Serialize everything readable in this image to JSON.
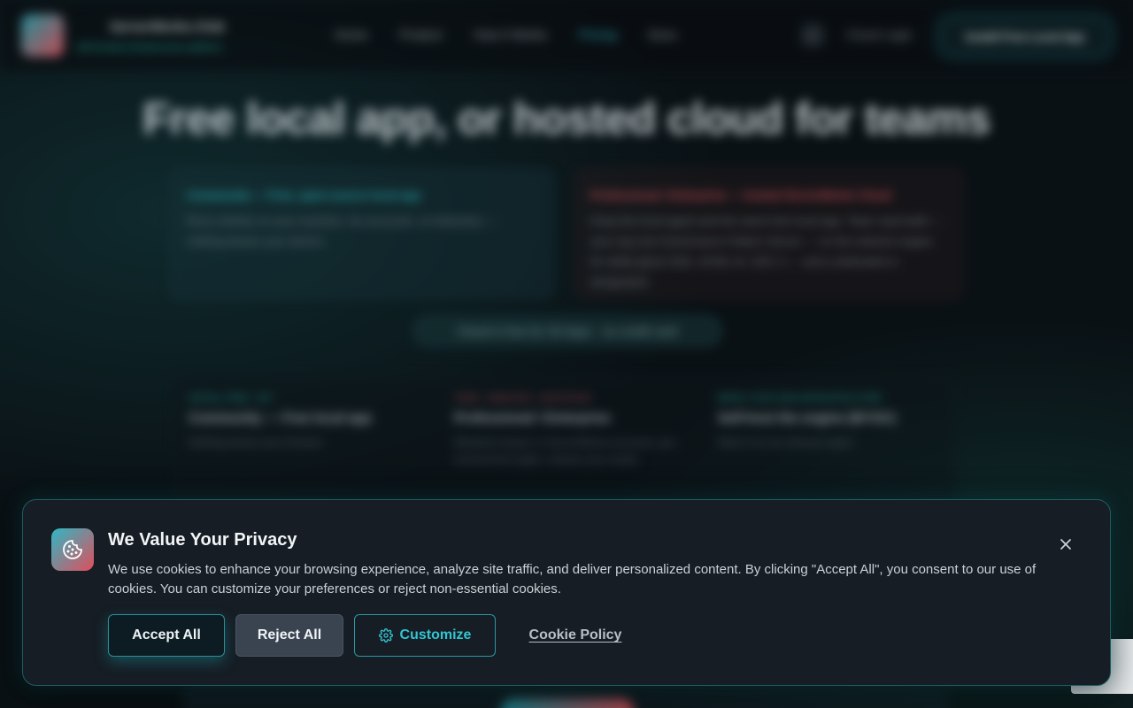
{
  "nav": {
    "brand": "ServerWorks.Club",
    "brand_sub": "Self-hosted infrastructure platform",
    "links": [
      "Home",
      "Product",
      "How it Works",
      "Pricing",
      "Docs"
    ],
    "active_link": "Pricing",
    "login_label": "Cloud Login",
    "cta_label": "Install Free Local App"
  },
  "hero": {
    "title": "Free local app, or hosted cloud for teams"
  },
  "plans": {
    "left": {
      "title": "Community — Free, open-source local app",
      "desc": "Runs entirely on your machine. No accounts, no telemetry — nothing leaves your device."
    },
    "right": {
      "title": "Professional / Enterprise — hosted ServerWorks Cloud",
      "desc": "Keep the local agent and the same free local app. Team seat build — your org runs Governance Pattern Server — on the network engine for white-glove SSO, SCIM, AI, SOC 2 — and a dedicated or designated."
    }
  },
  "trial": {
    "label": "Cloud is free for 30 days · no credit card"
  },
  "tiers": [
    {
      "kicker": "INSTALL FREE · MIT",
      "name": "Community — Free local app",
      "desc": "Nothing leaves your browser"
    },
    {
      "kicker": "TEAM · SAML/SSO · AUDIT/SCIM",
      "name": "Professional / Enterprise",
      "desc": "Windows-based, in ServerWorks accounts, per-environment rights, release your needs"
    },
    {
      "kicker": "BRING YOUR OWN INFRASTRUCTURE",
      "name": "Self-host the engine (BYOC)",
      "desc": "Want it on our internal region"
    }
  ],
  "cookie": {
    "title": "We Value Your Privacy",
    "text": "We use cookies to enhance your browsing experience, analyze site traffic, and deliver personalized content. By clicking \"Accept All\", you consent to our use of cookies. You can customize your preferences or reject non-essential cookies.",
    "accept_label": "Accept All",
    "reject_label": "Reject All",
    "customize_label": "Customize",
    "policy_label": "Cookie Policy",
    "icon": "cookie-icon",
    "close_icon": "close-icon",
    "customize_icon": "gear-icon"
  },
  "colors": {
    "accent_teal": "#2fc6d4",
    "accent_red": "#e0545f",
    "banner_bg": "#161d24",
    "banner_border": "#1d5c63",
    "reject_bg": "#3a4450"
  }
}
